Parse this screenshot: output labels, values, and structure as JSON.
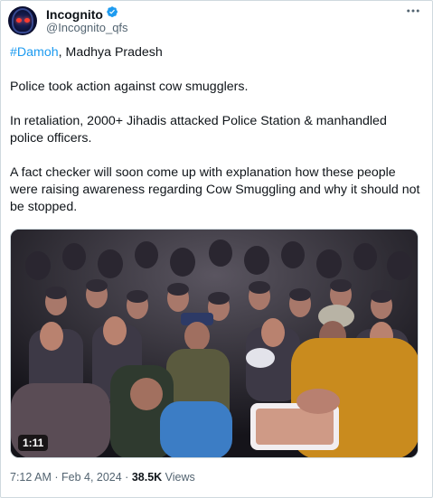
{
  "author": {
    "display_name": "Incognito",
    "handle": "@Incognito_qfs",
    "verified": true,
    "avatar_icon": "hooded-figure-avatar"
  },
  "menu_icon": "more-horizontal-icon",
  "tweet": {
    "hashtag": "#Damoh",
    "location_suffix": ", Madhya Pradesh",
    "paragraph_2": "Police took action against cow smugglers.",
    "paragraph_3": "In retaliation, 2000+ Jihadis attacked Police Station & manhandled police officers.",
    "paragraph_4": "A fact checker will soon come up with explanation how these people were raising awareness regarding Cow Smuggling and why it should not be stopped."
  },
  "media": {
    "type": "video",
    "duration": "1:11"
  },
  "meta": {
    "time": "7:12 AM",
    "separator": " · ",
    "date": "Feb 4, 2024",
    "views_count": "38.5K",
    "views_label": " Views"
  },
  "colors": {
    "accent": "#1d9bf0",
    "text": "#0f1419",
    "muted": "#536471",
    "border": "#cfd9de"
  }
}
